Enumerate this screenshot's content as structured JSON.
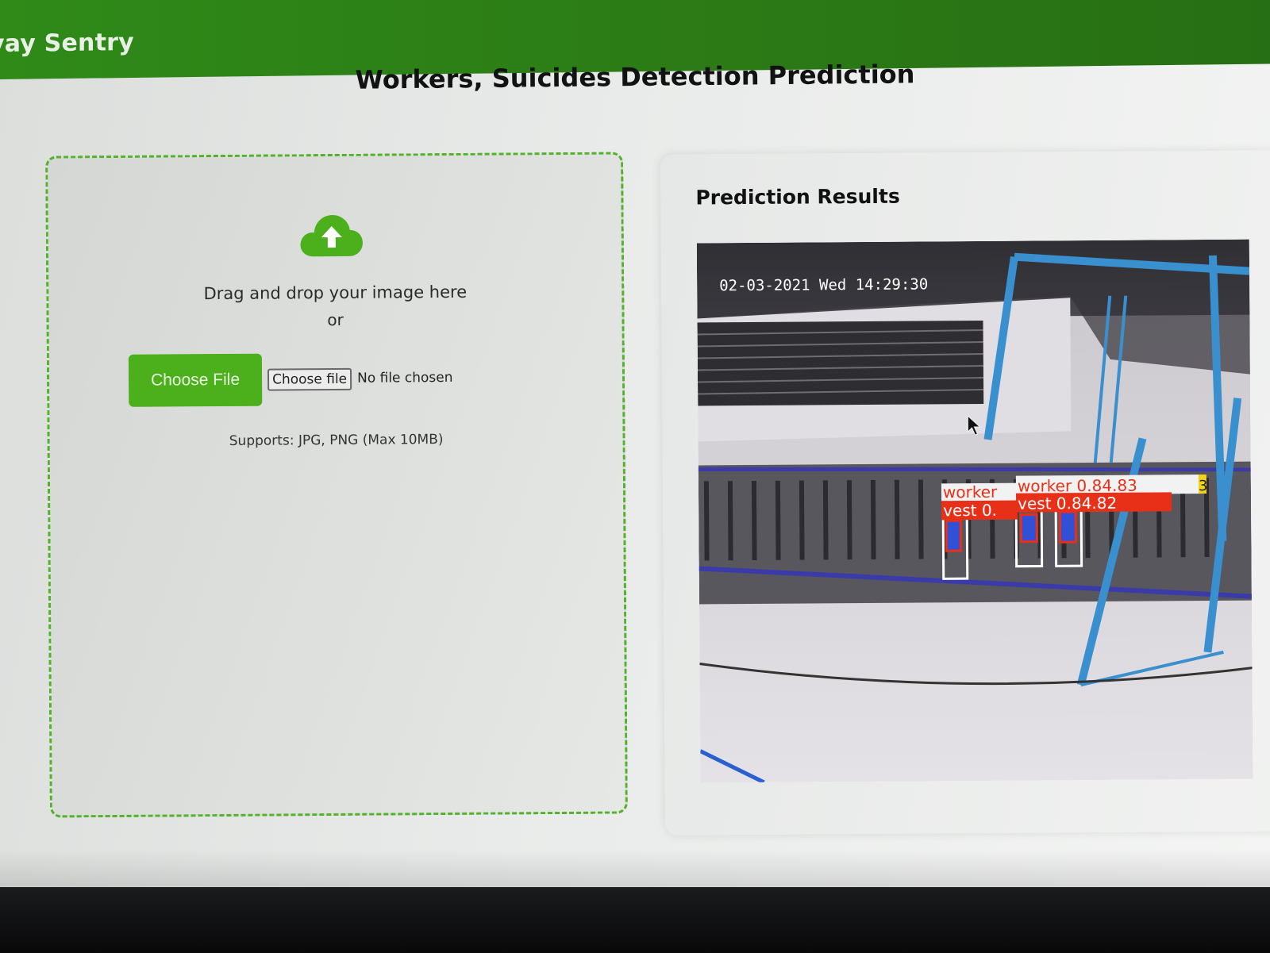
{
  "header": {
    "brand": "vay Sentry",
    "brand_color": "#2c7c16"
  },
  "page_title": "Workers, Suicides Detection Prediction",
  "upload": {
    "icon": "cloud-upload-icon",
    "drag_text": "Drag and drop your image here",
    "or_text": "or",
    "choose_button": "Choose File",
    "native_button": "Choose file",
    "no_file_text": "No file chosen",
    "supports_text": "Supports: JPG, PNG (Max 10MB)",
    "accent_color": "#4caf1c"
  },
  "results": {
    "title": "Prediction Results",
    "image": {
      "timestamp": "02-03-2021 Wed 14:29:30",
      "labels": {
        "worker_a": "worker",
        "worker_b": "worker 0.84.83",
        "vest_a": "vest 0.",
        "vest_b": "vest 0.84.82",
        "extra": "3"
      }
    }
  }
}
